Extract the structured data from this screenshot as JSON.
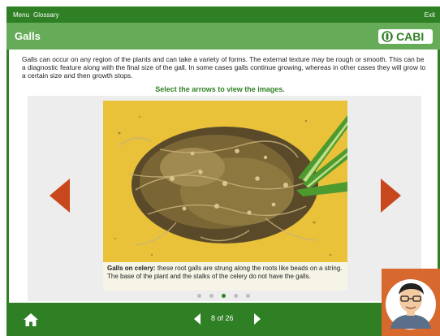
{
  "topbar": {
    "menu": "Menu",
    "glossary": "Glossary",
    "exit": "Exit"
  },
  "header": {
    "title": "Galls",
    "logo_text": "CABI"
  },
  "content": {
    "description": "Galls can occur on any region of the plants and can take a variety of forms. The external texture may be rough or smooth. This can be a diagnostic feature along with the final size of the gall. In some cases galls continue growing, whereas in other cases they will grow to a certain size and then growth stops.",
    "instruction": "Select the arrows to view the images."
  },
  "slide": {
    "caption_title": "Galls on celery:",
    "caption_text": " these root galls are strung along the roots like beads on a string. The base of the plant and the stalks of the celery do not have the galls.",
    "dots_total": 5,
    "dots_active_index": 2
  },
  "footer": {
    "pager": "8 of 26"
  },
  "icons": {
    "home": "home-icon",
    "prev_slide": "arrow-left-icon",
    "next_slide": "arrow-right-icon",
    "prev_page": "chevron-left-icon",
    "next_page": "chevron-right-icon",
    "logo": "cabi-logo-icon"
  },
  "colors": {
    "dark_green": "#2f7f24",
    "light_green": "#66ac58",
    "arrow_orange": "#c9471d",
    "avatar_bg": "#d7682e",
    "photo_bg": "#e9c23a"
  }
}
